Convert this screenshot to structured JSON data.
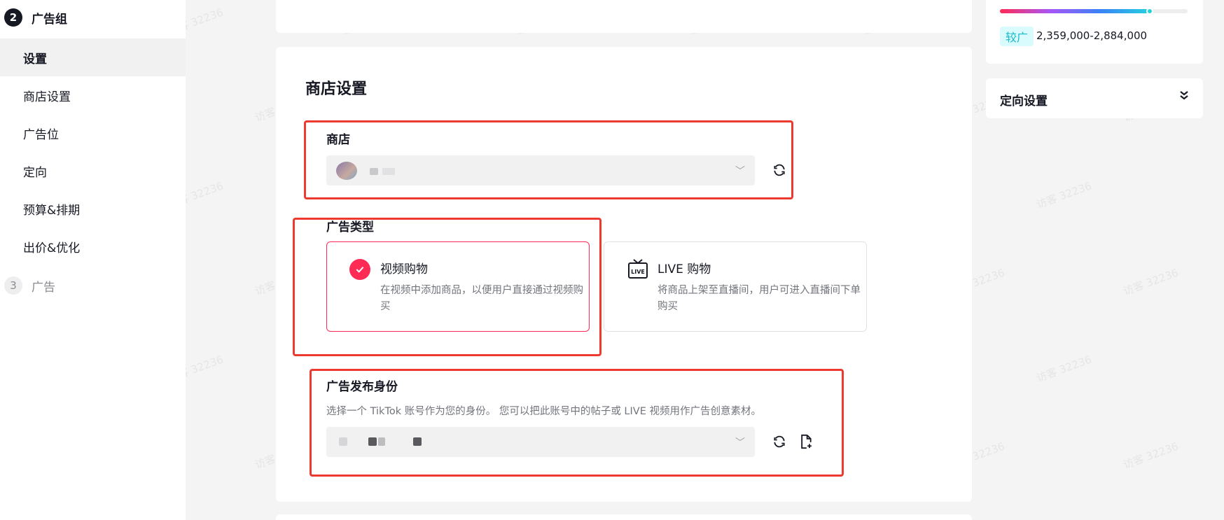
{
  "sidebar": {
    "step2": {
      "num": "2",
      "label": "广告组"
    },
    "items": [
      {
        "label": "设置"
      },
      {
        "label": "商店设置"
      },
      {
        "label": "广告位"
      },
      {
        "label": "定向"
      },
      {
        "label": "预算&排期"
      },
      {
        "label": "出价&优化"
      }
    ],
    "step3": {
      "num": "3",
      "label": "广告"
    }
  },
  "shop_settings": {
    "title": "商店设置",
    "shop_label": "商店",
    "ad_type_label": "广告类型",
    "ad_types": [
      {
        "title": "视频购物",
        "desc": "在视频中添加商品，以便用户直接通过视频购买",
        "selected": true
      },
      {
        "title": "LIVE 购物",
        "desc": "将商品上架至直播间，用户可进入直播间下单购买",
        "selected": false
      }
    ],
    "identity_label": "广告发布身份",
    "identity_helper": "选择一个 TikTok 账号作为您的身份。 您可以把此账号中的帖子或 LIVE 视频用作广告创意素材。"
  },
  "audience": {
    "fill_fraction": 0.8,
    "tag": "较广",
    "range": "2,359,000-2,884,000"
  },
  "targeting_panel": {
    "title": "定向设置"
  },
  "watermark": "访客 32236",
  "colors": {
    "accent": "#fe2c55",
    "highlight": "#ec3b2e",
    "audience": "#25d0e0"
  }
}
